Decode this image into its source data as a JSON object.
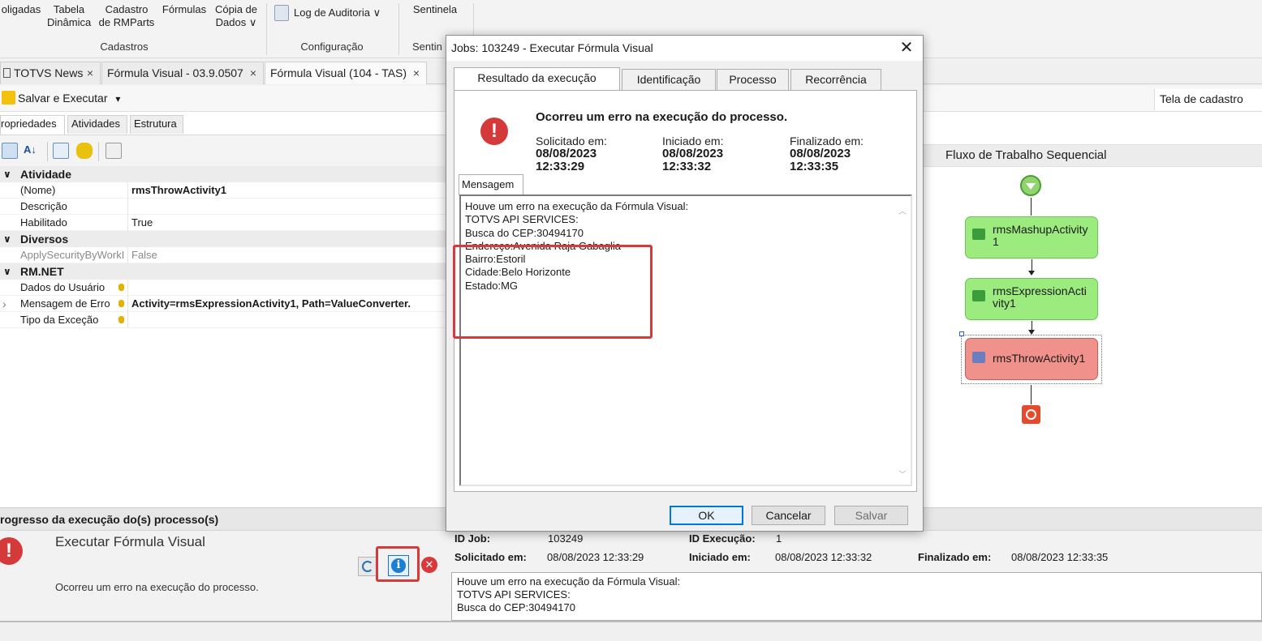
{
  "ribbon": {
    "buttons": [
      "oligadas",
      "Tabela\nDinâmica",
      "Cadastro\nde RMParts",
      "Fórmulas",
      "Cópia de\nDados ∨",
      "Log de Auditoria ∨",
      "Sentinela"
    ],
    "groups": [
      "Cadastros",
      "Configuração",
      "Sentin"
    ]
  },
  "doc_tabs": [
    {
      "label": "TOTVS News",
      "close": "×"
    },
    {
      "label": "Fórmula Visual - 03.9.0507",
      "close": "×"
    },
    {
      "label": "Fórmula Visual (104 - TAS)",
      "close": "×"
    }
  ],
  "toolbar": {
    "save_execute": "Salvar e Executar",
    "dropdown": "▾"
  },
  "tela_de_cadastro": "Tela de cadastro",
  "props": {
    "tabs": [
      "ropriedades",
      "Atividades",
      "Estrutura"
    ],
    "categories": [
      {
        "chev": "∨",
        "label": "Atividade",
        "rows": [
          {
            "name": "(Nome)",
            "value": "rmsThrowActivity1",
            "bold": true
          },
          {
            "name": "Descrição",
            "value": ""
          },
          {
            "name": "Habilitado",
            "value": "True"
          }
        ]
      },
      {
        "chev": "∨",
        "label": "Diversos",
        "rows": [
          {
            "name": "ApplySecurityByWorkI",
            "value": "False",
            "grey": true
          }
        ]
      },
      {
        "chev": "∨",
        "label": "RM.NET",
        "rows": [
          {
            "name": "Dados do Usuário",
            "value": "",
            "db": true
          },
          {
            "name": "Mensagem de Erro",
            "value": "Activity=rmsExpressionActivity1, Path=ValueConverter.",
            "db": true,
            "bold": true,
            "expand": "›"
          },
          {
            "name": "Tipo da Exceção",
            "value": "",
            "db": true
          }
        ]
      }
    ]
  },
  "designer": {
    "title": "Fluxo de Trabalho Sequencial",
    "activities": [
      {
        "label": "rmsMashupActivity 1",
        "kind": "green"
      },
      {
        "label": "rmsExpressionActi vity1",
        "kind": "green"
      },
      {
        "label": "rmsThrowActivity1",
        "kind": "red"
      }
    ]
  },
  "progress": {
    "header": "rogresso da execução do(s) processo(s)",
    "process_name": "Executar Fórmula Visual",
    "process_status": "Ocorreu um erro na execução do processo.",
    "fields": {
      "id_job_label": "ID Job:",
      "id_job": "103249",
      "id_exec_label": "ID Execução:",
      "id_exec": "1",
      "solicitado_label": "Solicitado em:",
      "solicitado": "08/08/2023 12:33:29",
      "iniciado_label": "Iniciado em:",
      "iniciado": "08/08/2023 12:33:32",
      "finalizado_label": "Finalizado em:",
      "finalizado": "08/08/2023 12:33:35"
    },
    "message": "Houve um erro na execução da Fórmula Visual:\nTOTVS API SERVICES:\nBusca do CEP:30494170"
  },
  "dialog": {
    "title": "Jobs: 103249 - Executar Fórmula Visual",
    "close": "✕",
    "tabs": [
      "Resultado da execução",
      "Identificação",
      "Processo",
      "Recorrência"
    ],
    "error_icon": "!",
    "heading": "Ocorreu um erro na execução do processo.",
    "solicitado_label": "Solicitado em:",
    "solicitado_date": "08/08/2023",
    "solicitado_time": "12:33:29",
    "iniciado_label": "Iniciado em:",
    "iniciado_date": "08/08/2023",
    "iniciado_time": "12:33:32",
    "finalizado_label": "Finalizado em:",
    "finalizado_date": "08/08/2023",
    "finalizado_time": "12:33:35",
    "message_tab": "Mensagem",
    "message": "Houve um erro na execução da Fórmula Visual:\nTOTVS API SERVICES:\nBusca do CEP:30494170\nEndereço:Avenida Raja Gabaglia\nBairro:Estoril\nCidade:Belo Horizonte\nEstado:MG",
    "buttons": {
      "ok": "OK",
      "cancel": "Cancelar",
      "save": "Salvar"
    }
  },
  "colors": {
    "error_red": "#d53a3a",
    "highlight": "#d63b3b",
    "activity_green": "#9beb7f",
    "activity_red": "#f0918b",
    "primary_blue": "#0078d7"
  }
}
